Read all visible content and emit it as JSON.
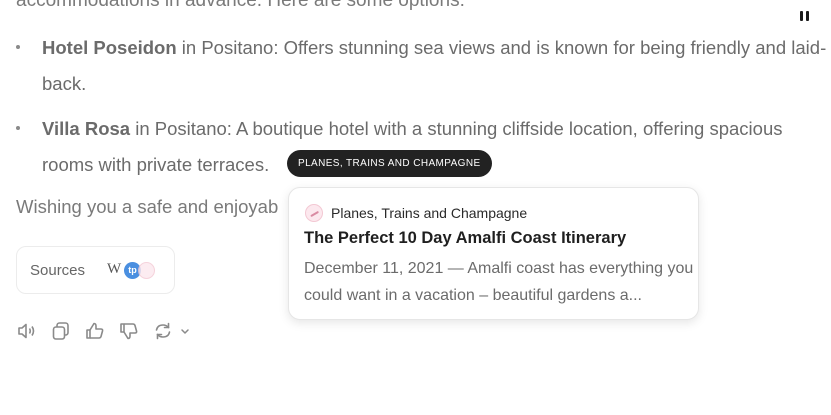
{
  "intro_line": "accommodations in advance. Here are some options:",
  "bullets": [
    {
      "name": "Hotel Poseidon",
      "rest": " in Positano: Offers stunning sea views and is known for being friendly and laid-back."
    },
    {
      "name": "Villa Rosa",
      "rest": " in Positano: A boutique hotel with a stunning cliffside location, offering spacious rooms with private terraces."
    }
  ],
  "tooltip_tag": "PLANES, TRAINS AND CHAMPAGNE",
  "closing_line": "Wishing you a safe and enjoyab",
  "popup": {
    "site_name": "Planes, Trains and Champagne",
    "title": "The Perfect 10 Day Amalfi Coast Itinerary",
    "snippet": "December 11, 2021 — Amalfi coast has everything you could want in a vacation – beautiful gardens a..."
  },
  "sources": {
    "label": "Sources",
    "wiki_glyph": "W",
    "tp_glyph": "tp"
  },
  "icons": [
    "pause-icon",
    "speaker-icon",
    "copy-icon",
    "thumbs-up-icon",
    "thumbs-down-icon",
    "regenerate-icon",
    "chevron-down-icon"
  ]
}
